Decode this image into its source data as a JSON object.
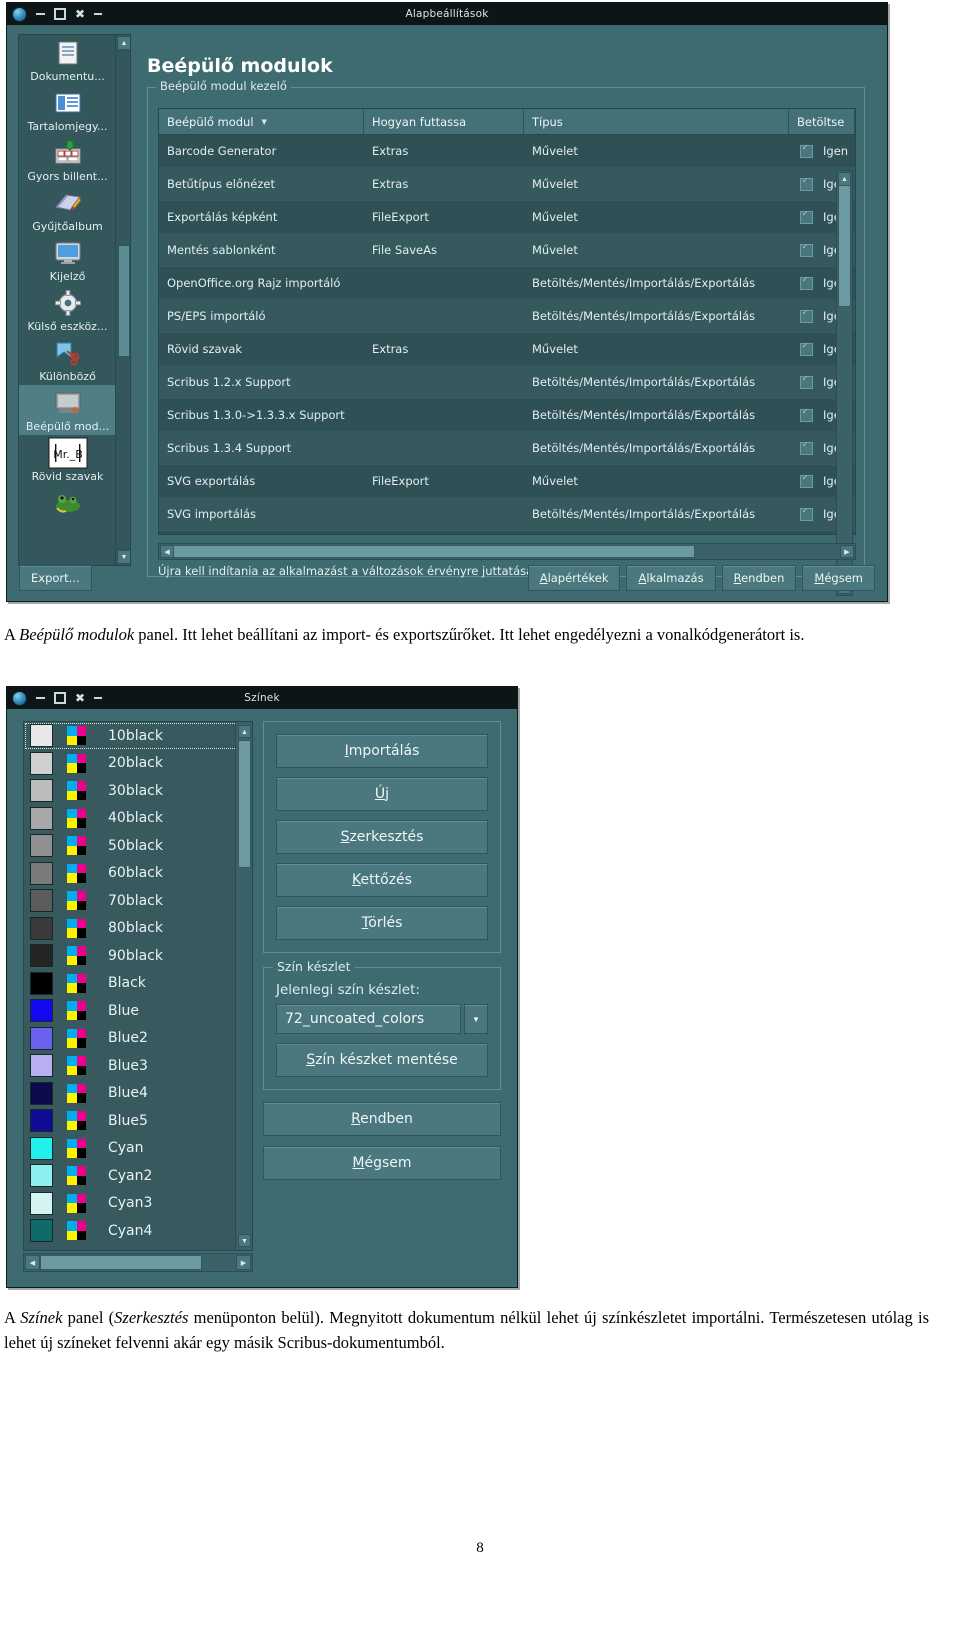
{
  "dialog_prefs": {
    "title": "Alapbeállítások",
    "heading": "Beépülő modulok",
    "group_legend": "Beépülő modul kezelő",
    "sidebar": [
      {
        "label": "Dokumentu...",
        "icon": "document-icon",
        "selected": false
      },
      {
        "label": "Tartalomjegy...",
        "icon": "table-of-contents-icon",
        "selected": false
      },
      {
        "label": "Gyors billent...",
        "icon": "keyboard-shortcuts-icon",
        "selected": false
      },
      {
        "label": "Gyűjtőalbum",
        "icon": "scrapbook-icon",
        "selected": false
      },
      {
        "label": "Kijelző",
        "icon": "monitor-icon",
        "selected": false
      },
      {
        "label": "Külső eszköz...",
        "icon": "gear-icon",
        "selected": false
      },
      {
        "label": "Különböző",
        "icon": "misc-scissors-icon",
        "selected": false
      },
      {
        "label": "Beépülő mod...",
        "icon": "plugins-icon",
        "selected": true
      },
      {
        "label": "Rövid szavak",
        "icon": "short-words-icon",
        "selected": false
      }
    ],
    "table": {
      "columns": [
        "Beépülő modul",
        "Hogyan futtassa",
        "Típus",
        "Betöltse"
      ],
      "sorted_column": "Beépülő modul",
      "rows": [
        {
          "plugin": "Barcode Generator",
          "how": "Extras",
          "type": "Művelet",
          "load": "Igen",
          "checked": true
        },
        {
          "plugin": "Betűtípus előnézet",
          "how": "Extras",
          "type": "Művelet",
          "load": "Igen",
          "checked": true
        },
        {
          "plugin": "Exportálás képként",
          "how": "FileExport",
          "type": "Művelet",
          "load": "Igen",
          "checked": true
        },
        {
          "plugin": "Mentés sablonként",
          "how": "File SaveAs",
          "type": "Művelet",
          "load": "Igen",
          "checked": true
        },
        {
          "plugin": "OpenOffice.org Rajz importáló",
          "how": "",
          "type": "Betöltés/Mentés/Importálás/Exportálás",
          "load": "Igen",
          "checked": true
        },
        {
          "plugin": "PS/EPS importáló",
          "how": "",
          "type": "Betöltés/Mentés/Importálás/Exportálás",
          "load": "Igen",
          "checked": true
        },
        {
          "plugin": "Rövid szavak",
          "how": "Extras",
          "type": "Művelet",
          "load": "Igen",
          "checked": true
        },
        {
          "plugin": "Scribus 1.2.x Support",
          "how": "",
          "type": "Betöltés/Mentés/Importálás/Exportálás",
          "load": "Igen",
          "checked": true
        },
        {
          "plugin": "Scribus 1.3.0->1.3.3.x Support",
          "how": "",
          "type": "Betöltés/Mentés/Importálás/Exportálás",
          "load": "Igen",
          "checked": true
        },
        {
          "plugin": "Scribus 1.3.4 Support",
          "how": "",
          "type": "Betöltés/Mentés/Importálás/Exportálás",
          "load": "Igen",
          "checked": true
        },
        {
          "plugin": "SVG exportálás",
          "how": "FileExport",
          "type": "Művelet",
          "load": "Igen",
          "checked": true
        },
        {
          "plugin": "SVG importálás",
          "how": "",
          "type": "Betöltés/Mentés/Importálás/Exportálás",
          "load": "Igen",
          "checked": true
        }
      ]
    },
    "restart_note": "Újra kell indítania az alkalmazást a változások érvényre juttatásához.",
    "buttons": {
      "export": "Export...",
      "defaults": "Alapértékek",
      "apply": "Alkalmazás",
      "ok": "Rendben",
      "cancel": "Mégsem"
    }
  },
  "dialog_colors": {
    "title": "Színek",
    "colors": [
      {
        "name": "10black",
        "hex": "#e8e8e8"
      },
      {
        "name": "20black",
        "hex": "#cfcfcf"
      },
      {
        "name": "30black",
        "hex": "#bcbcbc"
      },
      {
        "name": "40black",
        "hex": "#a8a8a8"
      },
      {
        "name": "50black",
        "hex": "#909090"
      },
      {
        "name": "60black",
        "hex": "#7a7a7a"
      },
      {
        "name": "70black",
        "hex": "#5c5c5c"
      },
      {
        "name": "80black",
        "hex": "#3a3a3a"
      },
      {
        "name": "90black",
        "hex": "#242424"
      },
      {
        "name": "Black",
        "hex": "#000000"
      },
      {
        "name": "Blue",
        "hex": "#1408f0"
      },
      {
        "name": "Blue2",
        "hex": "#6e61f0"
      },
      {
        "name": "Blue3",
        "hex": "#b9aef2"
      },
      {
        "name": "Blue4",
        "hex": "#0c0a4a"
      },
      {
        "name": "Blue5",
        "hex": "#130b96"
      },
      {
        "name": "Cyan",
        "hex": "#21f0ec"
      },
      {
        "name": "Cyan2",
        "hex": "#8df0ef"
      },
      {
        "name": "Cyan3",
        "hex": "#d3f4f3"
      },
      {
        "name": "Cyan4",
        "hex": "#0f6a6a"
      }
    ],
    "selected_color": "10black",
    "buttons": {
      "import": "Importálás",
      "new": "Új",
      "edit": "Szerkesztés",
      "duplicate": "Kettőzés",
      "delete": "Törlés",
      "save_set": "Szín készket mentése",
      "ok": "Rendben",
      "cancel": "Mégsem"
    },
    "colorset": {
      "legend": "Szín készlet",
      "label": "Jelenlegi szín készlet:",
      "value": "72_uncoated_colors"
    }
  },
  "captions": {
    "caption1_html": "A <i>Beépülő modulok</i> panel. Itt lehet beállítani az import- és exportszűrőket. Itt lehet engedélyezni a vonalkódgenerátort is.",
    "caption2_html": "A <i>Színek</i> panel (<i>Szerkesztés</i> menüponton belül). Megnyitott dokumentum nélkül lehet új színkészletet importálni. Természetesen utólag is lehet új színeket felvenni akár egy másik Scribus-dokumentumból."
  },
  "page_number": "8"
}
